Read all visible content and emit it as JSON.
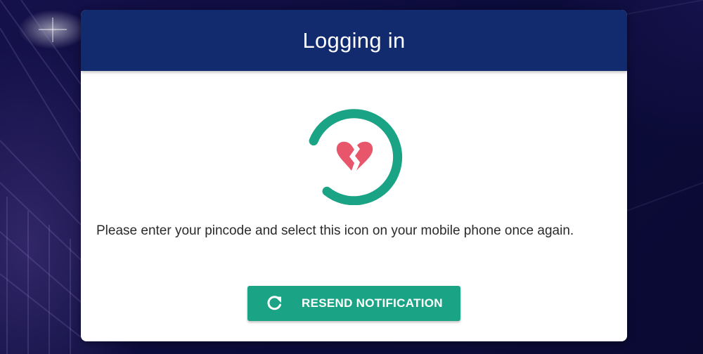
{
  "dialog": {
    "title": "Logging in",
    "status_icon": "broken-heart-icon",
    "message": "Please enter your pincode and select this icon on your mobile phone once again.",
    "resend_button": {
      "label": "RESEND NOTIFICATION",
      "icon": "refresh-icon"
    }
  },
  "colors": {
    "header": "#122a6e",
    "accent": "#1aa384",
    "heart": "#e8566c"
  }
}
